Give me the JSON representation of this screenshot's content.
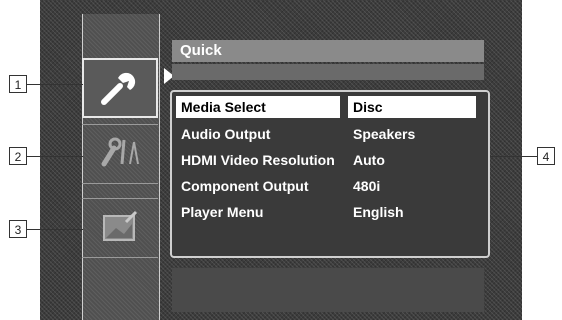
{
  "header": {
    "title": "Quick"
  },
  "sidebar": {
    "items": [
      {
        "icon": "wrench-icon",
        "selected": true
      },
      {
        "icon": "tools-icon",
        "selected": false
      },
      {
        "icon": "picture-settings-icon",
        "selected": false
      }
    ]
  },
  "menu": {
    "rows": [
      {
        "label": "Media Select",
        "value": "Disc"
      },
      {
        "label": "Audio Output",
        "value": "Speakers"
      },
      {
        "label": "HDMI Video Resolution",
        "value": "Auto"
      },
      {
        "label": "Component Output",
        "value": "480i"
      },
      {
        "label": "Player Menu",
        "value": "English"
      }
    ]
  },
  "callouts": [
    "1",
    "2",
    "3",
    "4"
  ]
}
